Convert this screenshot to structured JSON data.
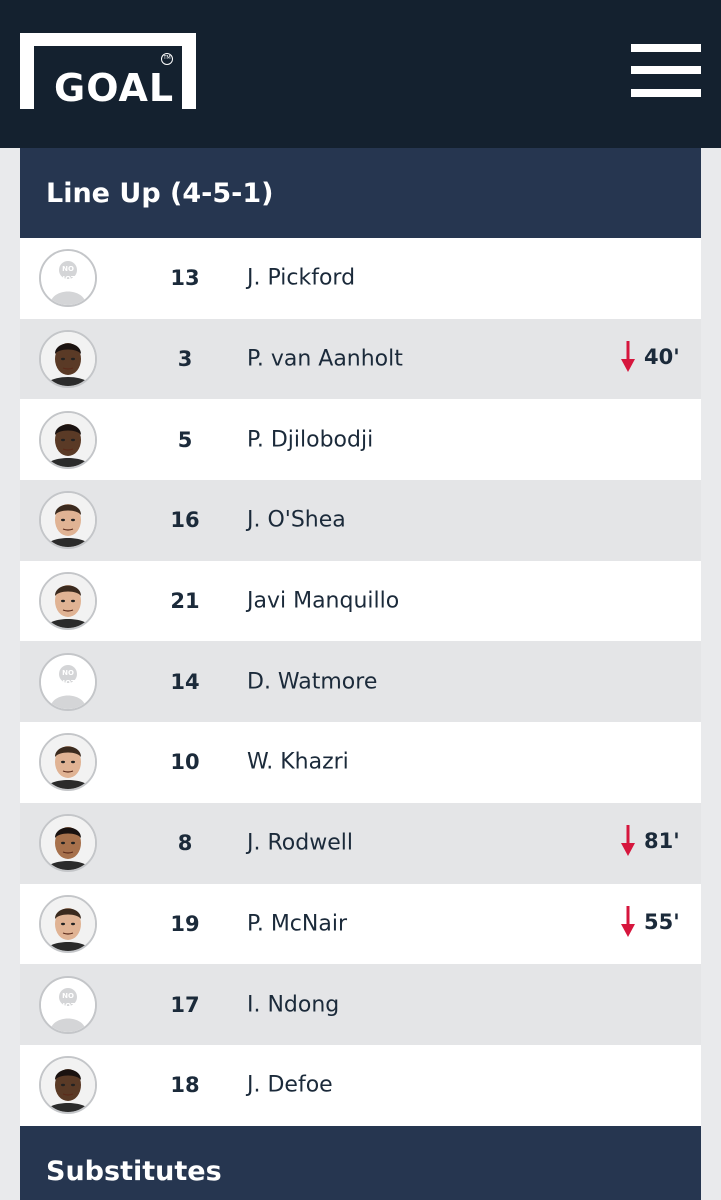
{
  "header": {
    "logo_text": "GOAL",
    "logo_tm": "TM",
    "menu_icon": "hamburger-menu-icon"
  },
  "lineup": {
    "title": "Line Up (4-5-1)",
    "players": [
      {
        "number": "13",
        "name": "J. Pickford",
        "photo": "none",
        "sub_minute": null
      },
      {
        "number": "3",
        "name": "P. van Aanholt",
        "photo": "dark",
        "sub_minute": "40'"
      },
      {
        "number": "5",
        "name": "P. Djilobodji",
        "photo": "dark",
        "sub_minute": null
      },
      {
        "number": "16",
        "name": "J. O'Shea",
        "photo": "light",
        "sub_minute": null
      },
      {
        "number": "21",
        "name": "Javi Manquillo",
        "photo": "light",
        "sub_minute": null
      },
      {
        "number": "14",
        "name": "D. Watmore",
        "photo": "none",
        "sub_minute": null
      },
      {
        "number": "10",
        "name": "W. Khazri",
        "photo": "light",
        "sub_minute": null
      },
      {
        "number": "8",
        "name": "J. Rodwell",
        "photo": "medium",
        "sub_minute": "81'"
      },
      {
        "number": "19",
        "name": "P. McNair",
        "photo": "light",
        "sub_minute": "55'"
      },
      {
        "number": "17",
        "name": "I. Ndong",
        "photo": "none",
        "sub_minute": null
      },
      {
        "number": "18",
        "name": "J. Defoe",
        "photo": "dark",
        "sub_minute": null
      }
    ]
  },
  "no_photo_text": [
    "NO",
    "PHOTO",
    "YET"
  ],
  "substitutes": {
    "title": "Substitutes"
  },
  "colors": {
    "topbar": "#14212f",
    "section_header": "#263650",
    "row_alt": "#e4e5e7",
    "sub_arrow": "#d6163d"
  }
}
